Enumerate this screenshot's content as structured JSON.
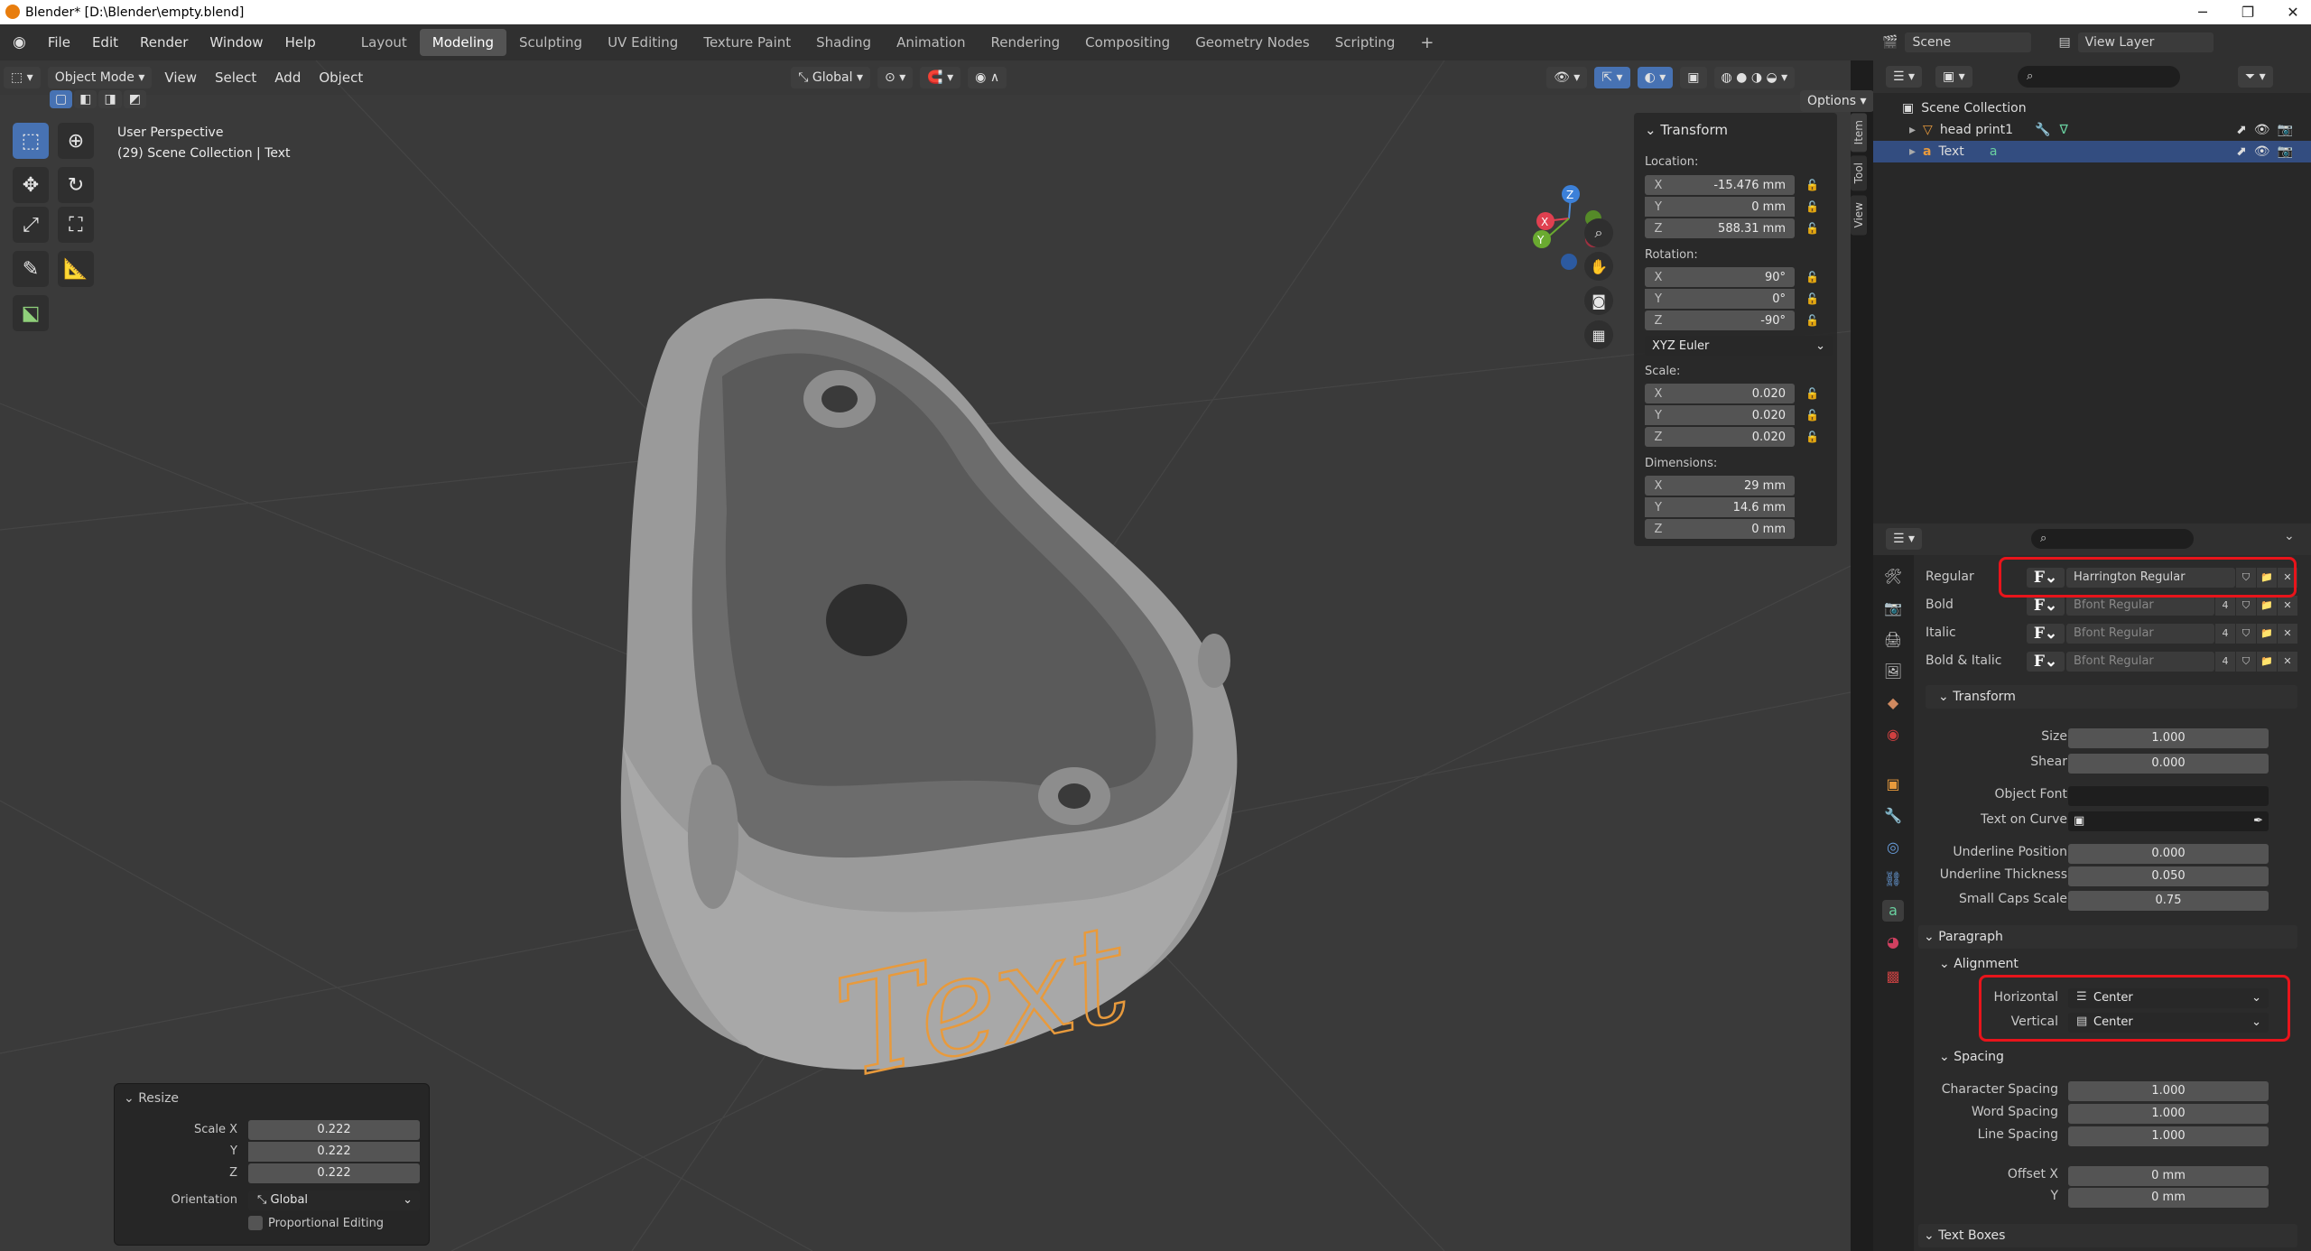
{
  "window": {
    "title": "Blender* [D:\\Blender\\empty.blend]"
  },
  "menus": [
    "File",
    "Edit",
    "Render",
    "Window",
    "Help"
  ],
  "workspaces": [
    "Layout",
    "Modeling",
    "Sculpting",
    "UV Editing",
    "Texture Paint",
    "Shading",
    "Animation",
    "Rendering",
    "Compositing",
    "Geometry Nodes",
    "Scripting"
  ],
  "active_workspace": "Modeling",
  "scene": {
    "name": "Scene",
    "view_layer": "View Layer"
  },
  "viewport": {
    "mode": "Object Mode",
    "menus": [
      "View",
      "Select",
      "Add",
      "Object"
    ],
    "orientation": "Global",
    "options": "Options",
    "info_line1": "User Perspective",
    "info_line2": "(29) Scene Collection | Text",
    "text_object": "Text"
  },
  "transform_panel": {
    "title": "Transform",
    "location_label": "Location:",
    "location": [
      {
        "axis": "X",
        "value": "-15.476 mm"
      },
      {
        "axis": "Y",
        "value": "0 mm"
      },
      {
        "axis": "Z",
        "value": "588.31 mm"
      }
    ],
    "rotation_label": "Rotation:",
    "rotation": [
      {
        "axis": "X",
        "value": "90°"
      },
      {
        "axis": "Y",
        "value": "0°"
      },
      {
        "axis": "Z",
        "value": "-90°"
      }
    ],
    "rotation_mode": "XYZ Euler",
    "scale_label": "Scale:",
    "scale": [
      {
        "axis": "X",
        "value": "0.020"
      },
      {
        "axis": "Y",
        "value": "0.020"
      },
      {
        "axis": "Z",
        "value": "0.020"
      }
    ],
    "dimensions_label": "Dimensions:",
    "dimensions": [
      {
        "axis": "X",
        "value": "29 mm"
      },
      {
        "axis": "Y",
        "value": "14.6 mm"
      },
      {
        "axis": "Z",
        "value": "0 mm"
      }
    ]
  },
  "side_tabs": [
    "Item",
    "Tool",
    "View"
  ],
  "resize_panel": {
    "title": "Resize",
    "scale_x_label": "Scale X",
    "scale_x": "0.222",
    "y_label": "Y",
    "y": "0.222",
    "z_label": "Z",
    "z": "0.222",
    "orientation_label": "Orientation",
    "orientation": "Global",
    "proportional": "Proportional Editing"
  },
  "outliner": {
    "root": "Scene Collection",
    "items": [
      {
        "name": "head print1",
        "selected": false
      },
      {
        "name": "Text",
        "selected": true
      }
    ]
  },
  "properties": {
    "fonts": [
      {
        "label": "Regular",
        "font": "Harrington Regular",
        "users": ""
      },
      {
        "label": "Bold",
        "font": "Bfont Regular",
        "users": "4"
      },
      {
        "label": "Italic",
        "font": "Bfont Regular",
        "users": "4"
      },
      {
        "label": "Bold & Italic",
        "font": "Bfont Regular",
        "users": "4"
      }
    ],
    "transform_title": "Transform",
    "size_label": "Size",
    "size": "1.000",
    "shear_label": "Shear",
    "shear": "0.000",
    "object_font_label": "Object Font",
    "text_on_curve_label": "Text on Curve",
    "underline_pos_label": "Underline Position",
    "underline_pos": "0.000",
    "underline_thick_label": "Underline Thickness",
    "underline_thick": "0.050",
    "small_caps_label": "Small Caps Scale",
    "small_caps": "0.75",
    "paragraph_title": "Paragraph",
    "alignment_title": "Alignment",
    "horizontal_label": "Horizontal",
    "horizontal": "Center",
    "vertical_label": "Vertical",
    "vertical": "Center",
    "spacing_title": "Spacing",
    "char_spacing_label": "Character Spacing",
    "char_spacing": "1.000",
    "word_spacing_label": "Word Spacing",
    "word_spacing": "1.000",
    "line_spacing_label": "Line Spacing",
    "line_spacing": "1.000",
    "offset_x_label": "Offset X",
    "offset_x": "0 mm",
    "offset_y_label": "Y",
    "offset_y": "0 mm",
    "text_boxes_title": "Text Boxes"
  },
  "colors": {
    "accent": "#4772b3",
    "selection_outline": "#e8141b",
    "text_object": "#e89a3c",
    "model": "#b9b9b9"
  }
}
